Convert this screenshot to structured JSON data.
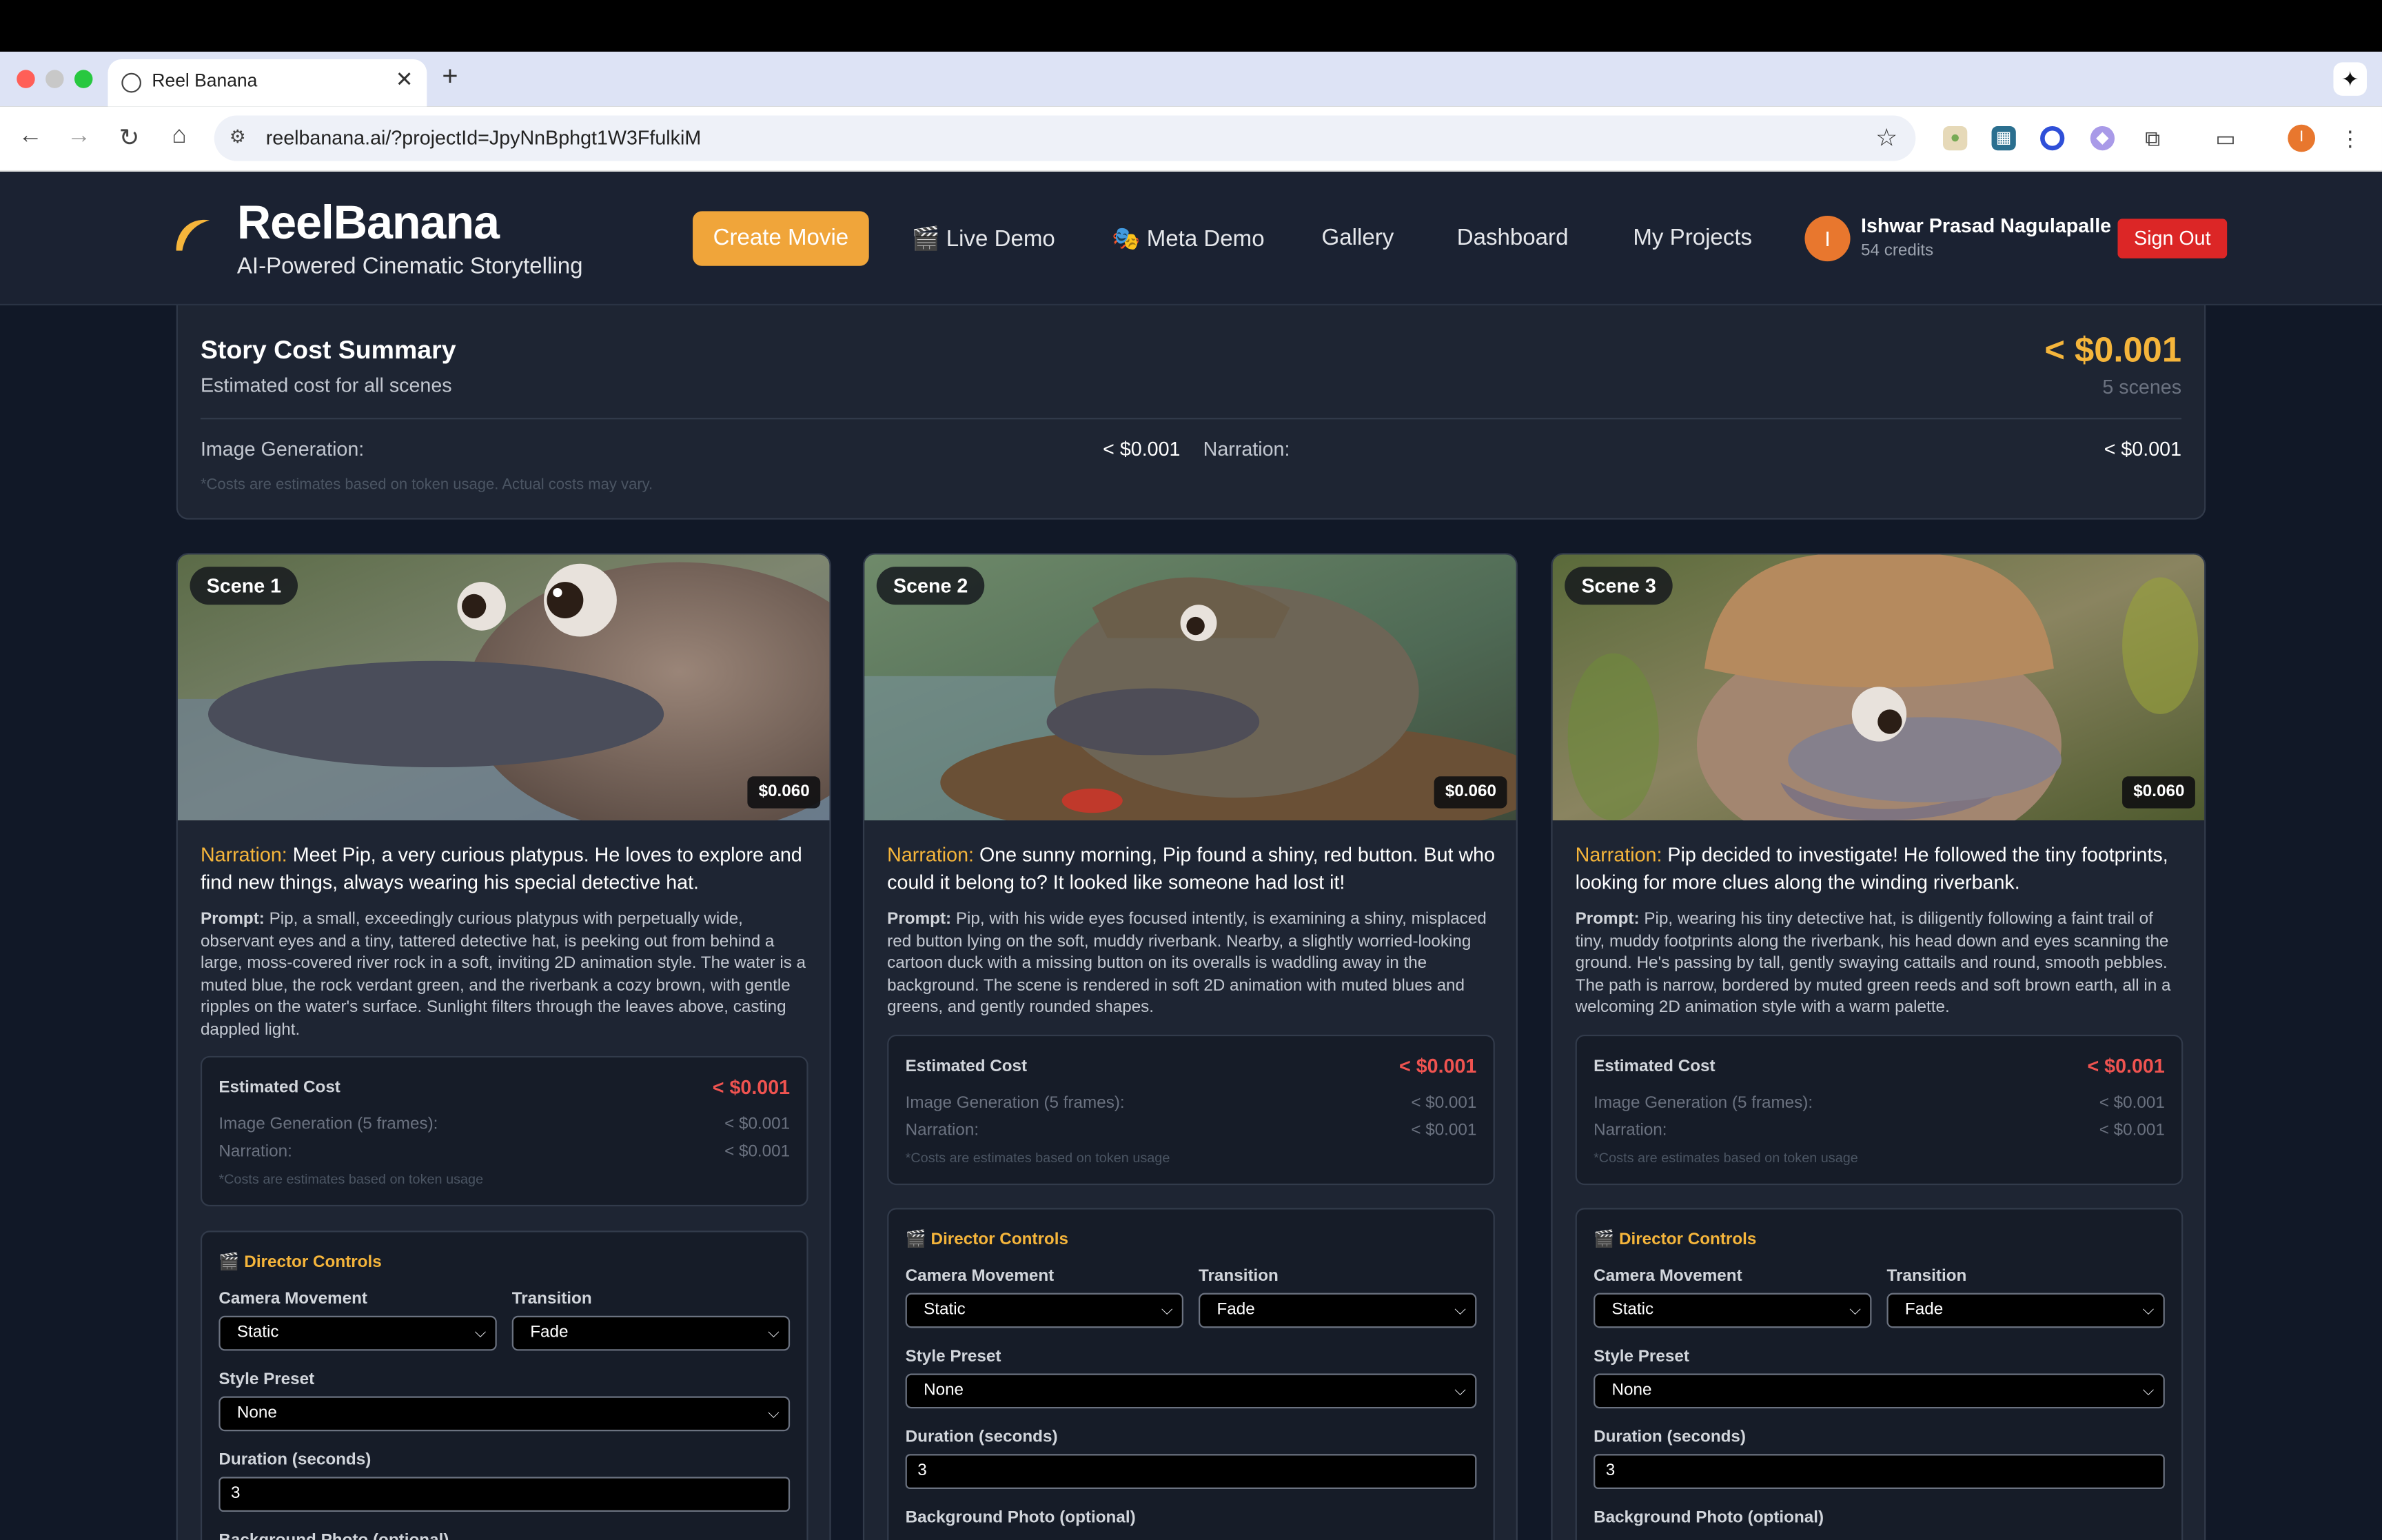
{
  "browser": {
    "tab_title": "Reel Banana",
    "url": "reelbanana.ai/?projectId=JpyNnBphgt1W3FfulkiM",
    "profile_initial": "I"
  },
  "header": {
    "brand": "ReelBanana",
    "tagline": "AI-Powered Cinematic Storytelling",
    "create_label": "Create Movie",
    "nav": {
      "live_demo": "🎬 Live Demo",
      "meta_demo": "🎭 Meta Demo",
      "gallery": "Gallery",
      "dashboard": "Dashboard",
      "my_projects": "My Projects"
    },
    "user": {
      "initial": "I",
      "name": "Ishwar Prasad Nagulapalle",
      "credits": "54 credits"
    },
    "signout_label": "Sign Out"
  },
  "summary": {
    "title": "Story Cost Summary",
    "subtitle": "Estimated cost for all scenes",
    "total": "< $0.001",
    "scene_count": "5 scenes",
    "image_label": "Image Generation:",
    "image_value": "< $0.001",
    "narration_label": "Narration:",
    "narration_value": "< $0.001",
    "note": "*Costs are estimates based on token usage. Actual costs may vary."
  },
  "scenes": [
    {
      "badge": "Scene 1",
      "price": "$0.060",
      "narration_key": "Narration:",
      "narration": " Meet Pip, a very curious platypus. He loves to explore and find new things, always wearing his special detective hat.",
      "prompt_key": "Prompt:",
      "prompt": " Pip, a small, exceedingly curious platypus with perpetually wide, observant eyes and a tiny, tattered detective hat, is peeking out from behind a large, moss-covered river rock in a soft, inviting 2D animation style. The water is a muted blue, the rock verdant green, and the riverbank a cozy brown, with gentle ripples on the water's surface. Sunlight filters through the leaves above, casting dappled light.",
      "cost": {
        "title": "Estimated Cost",
        "total": "< $0.001",
        "image_label": "Image Generation (5 frames):",
        "image_value": "< $0.001",
        "narration_label": "Narration:",
        "narration_value": "< $0.001",
        "note": "*Costs are estimates based on token usage"
      },
      "director": {
        "title": "🎬 Director Controls",
        "camera_label": "Camera Movement",
        "camera_value": "Static",
        "transition_label": "Transition",
        "transition_value": "Fade",
        "style_label": "Style Preset",
        "style_value": "None",
        "duration_label": "Duration (seconds)",
        "duration_value": "3",
        "bg_label": "Background Photo (optional)"
      }
    },
    {
      "badge": "Scene 2",
      "price": "$0.060",
      "narration_key": "Narration:",
      "narration": " One sunny morning, Pip found a shiny, red button. But who could it belong to? It looked like someone had lost it!",
      "prompt_key": "Prompt:",
      "prompt": " Pip, with his wide eyes focused intently, is examining a shiny, misplaced red button lying on the soft, muddy riverbank. Nearby, a slightly worried-looking cartoon duck with a missing button on its overalls is waddling away in the background. The scene is rendered in soft 2D animation with muted blues and greens, and gently rounded shapes.",
      "cost": {
        "title": "Estimated Cost",
        "total": "< $0.001",
        "image_label": "Image Generation (5 frames):",
        "image_value": "< $0.001",
        "narration_label": "Narration:",
        "narration_value": "< $0.001",
        "note": "*Costs are estimates based on token usage"
      },
      "director": {
        "title": "🎬 Director Controls",
        "camera_label": "Camera Movement",
        "camera_value": "Static",
        "transition_label": "Transition",
        "transition_value": "Fade",
        "style_label": "Style Preset",
        "style_value": "None",
        "duration_label": "Duration (seconds)",
        "duration_value": "3",
        "bg_label": "Background Photo (optional)"
      }
    },
    {
      "badge": "Scene 3",
      "price": "$0.060",
      "narration_key": "Narration:",
      "narration": " Pip decided to investigate! He followed the tiny footprints, looking for more clues along the winding riverbank.",
      "prompt_key": "Prompt:",
      "prompt": " Pip, wearing his tiny detective hat, is diligently following a faint trail of tiny, muddy footprints along the riverbank, his head down and eyes scanning the ground. He's passing by tall, gently swaying cattails and round, smooth pebbles. The path is narrow, bordered by muted green reeds and soft brown earth, all in a welcoming 2D animation style with a warm palette.",
      "cost": {
        "title": "Estimated Cost",
        "total": "< $0.001",
        "image_label": "Image Generation (5 frames):",
        "image_value": "< $0.001",
        "narration_label": "Narration:",
        "narration_value": "< $0.001",
        "note": "*Costs are estimates based on token usage"
      },
      "director": {
        "title": "🎬 Director Controls",
        "camera_label": "Camera Movement",
        "camera_value": "Static",
        "transition_label": "Transition",
        "transition_value": "Fade",
        "style_label": "Style Preset",
        "style_value": "None",
        "duration_label": "Duration (seconds)",
        "duration_value": "3",
        "bg_label": "Background Photo (optional)"
      }
    }
  ]
}
